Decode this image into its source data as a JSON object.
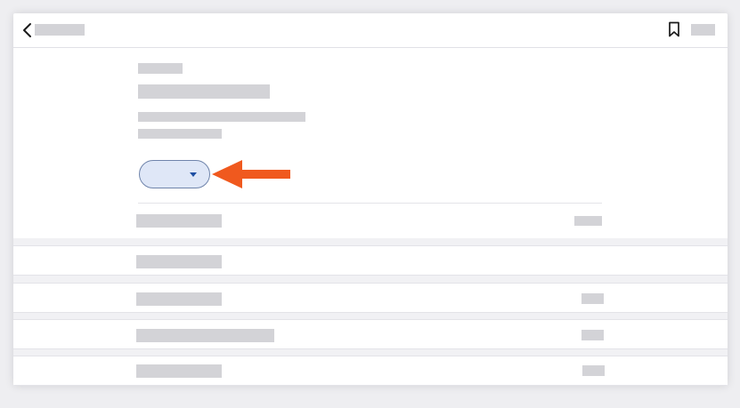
{
  "colors": {
    "placeholder": "#d3d3d7",
    "dropdown_fill": "#dfe7f7",
    "dropdown_border": "#6f84ab",
    "caret": "#1f4fa3",
    "annotation_arrow": "#f0591e"
  },
  "icons": {
    "back": "chevron-left",
    "bookmark": "bookmark-outline",
    "dropdown": "caret-down",
    "annotation": "arrow-left"
  }
}
